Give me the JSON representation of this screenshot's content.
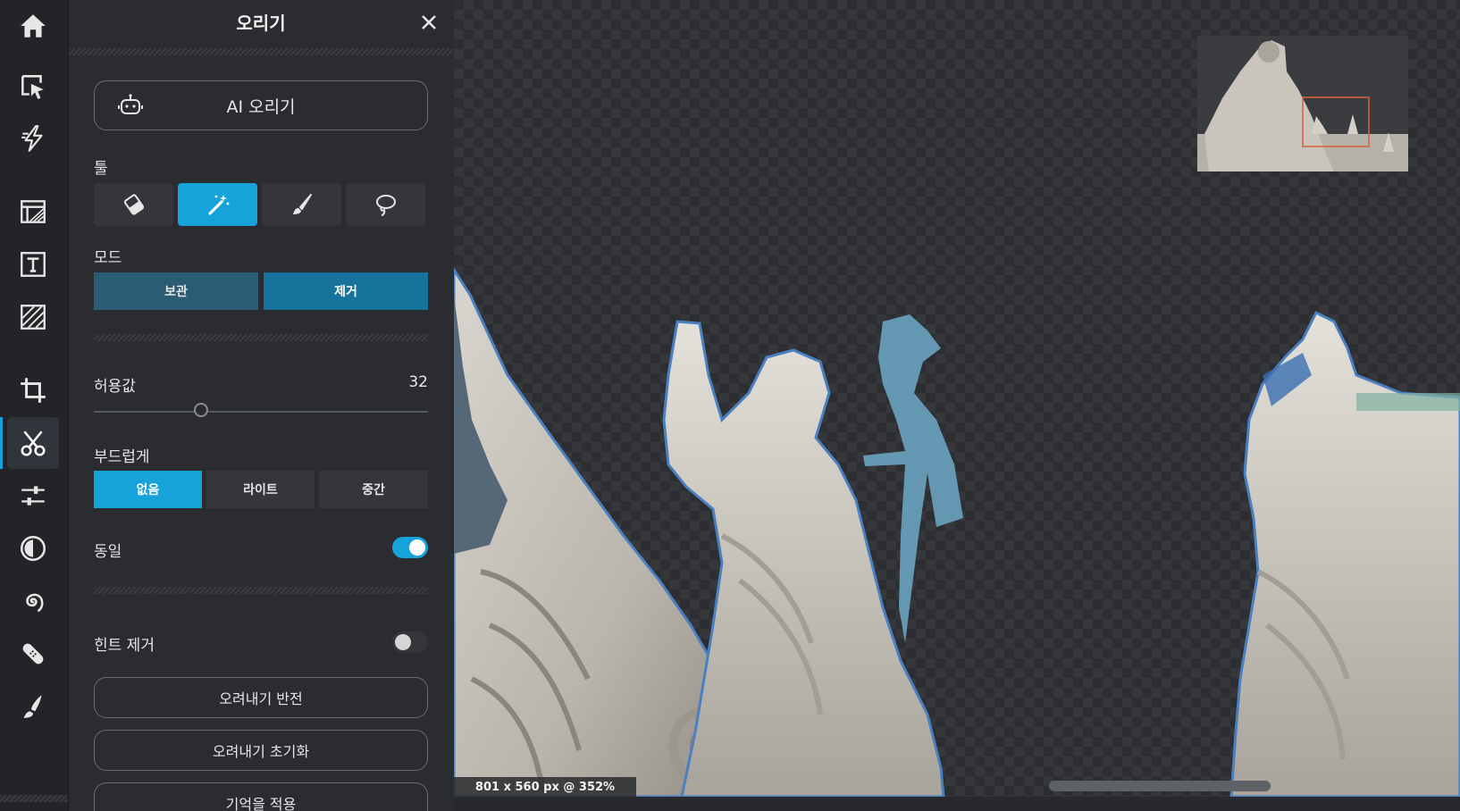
{
  "rail": {
    "items": [
      {
        "name": "home-icon"
      },
      {
        "name": "select-tool-icon"
      },
      {
        "name": "quick-actions-icon"
      },
      {
        "name": "layers-icon"
      },
      {
        "name": "text-icon"
      },
      {
        "name": "texture-icon"
      },
      {
        "name": "crop-icon"
      },
      {
        "name": "cutout-icon",
        "active": true
      },
      {
        "name": "adjust-icon"
      },
      {
        "name": "contrast-icon"
      },
      {
        "name": "swirl-icon"
      },
      {
        "name": "heal-icon"
      },
      {
        "name": "brush-icon"
      }
    ],
    "accent": "#1aa0d8"
  },
  "panel": {
    "title": "오리기",
    "ai_button": "AI 오리기",
    "tools_label": "툴",
    "tools": [
      {
        "name": "eraser-icon",
        "active": false
      },
      {
        "name": "magic-wand-icon",
        "active": true
      },
      {
        "name": "paint-brush-icon",
        "active": false
      },
      {
        "name": "lasso-icon",
        "active": false
      }
    ],
    "mode_label": "모드",
    "mode_options": [
      "보관",
      "제거"
    ],
    "mode_selected": "제거",
    "tolerance_label": "허용값",
    "tolerance_value": "32",
    "tolerance_max": 100,
    "smooth_label": "부드럽게",
    "smooth_options": [
      "없음",
      "라이트",
      "중간"
    ],
    "smooth_selected": "없음",
    "contiguous_label": "동일",
    "contiguous_on": true,
    "tint_label": "힌트 제거",
    "tint_on": false,
    "invert_button": "오려내기 반전",
    "reset_button": "오려내기 초기화",
    "apply_button_partial": "기억을 적용"
  },
  "canvas": {
    "status": "801 x 560 px @ 352%",
    "selection_color": "#4a90d8",
    "navigator_frame_color": "#d9603a"
  },
  "colors": {
    "accent": "#16a3d9",
    "mode_inactive": "#2a5d74",
    "mode_active": "#17739b",
    "panel_bg": "#2a2c30",
    "rail_bg": "#232427"
  }
}
